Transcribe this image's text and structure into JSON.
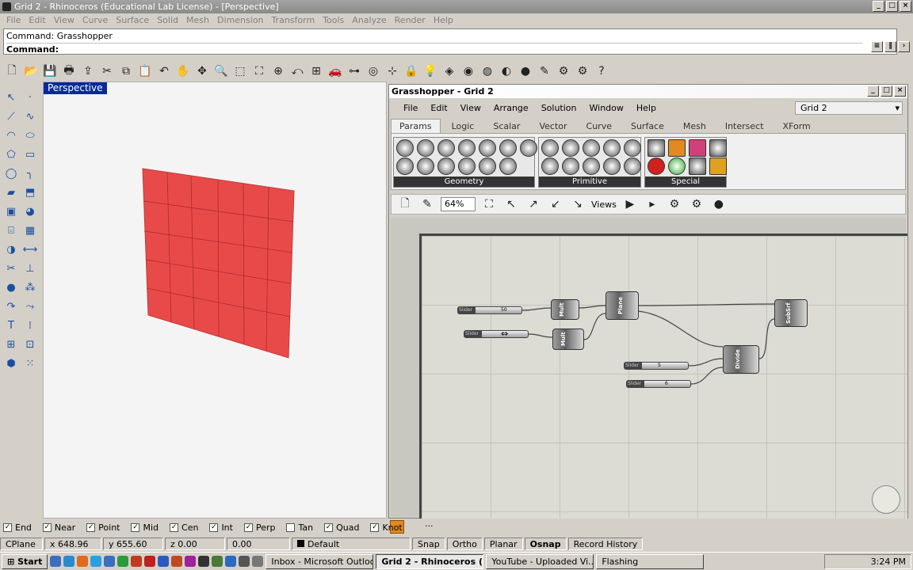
{
  "window": {
    "title": "Grid 2 - Rhinoceros (Educational Lab License) - [Perspective]"
  },
  "menu": [
    "File",
    "Edit",
    "View",
    "Curve",
    "Surface",
    "Solid",
    "Mesh",
    "Dimension",
    "Transform",
    "Tools",
    "Analyze",
    "Render",
    "Help"
  ],
  "command": {
    "line1": "Command: Grasshopper",
    "line2": "Command:"
  },
  "viewport": {
    "title": "Perspective",
    "surface_color": "#e84a4a"
  },
  "grasshopper": {
    "title": "Grasshopper - Grid 2",
    "menu": [
      "File",
      "Edit",
      "View",
      "Arrange",
      "Solution",
      "Window",
      "Help"
    ],
    "document": "Grid 2",
    "tabs": [
      "Params",
      "Logic",
      "Scalar",
      "Vector",
      "Curve",
      "Surface",
      "Mesh",
      "Intersect",
      "XForm"
    ],
    "active_tab": "Params",
    "groups": [
      "Geometry",
      "Primitive",
      "Special"
    ],
    "zoom": "64%",
    "views_label": "Views",
    "components": {
      "mult1": "Mult",
      "mult2": "Mult",
      "plane": "Plane",
      "divide": "Divide",
      "subsrf": "SubSrf"
    },
    "sliders": {
      "s1_tag": "Slider",
      "s1_val": "50",
      "s2_tag": "Slider",
      "s3_tag": "Slider",
      "s3_val": "5",
      "s4_tag": "Slider",
      "s4_val": "6"
    },
    "status_dots": "···"
  },
  "osnap": [
    {
      "label": "End",
      "checked": true
    },
    {
      "label": "Near",
      "checked": true
    },
    {
      "label": "Point",
      "checked": true
    },
    {
      "label": "Mid",
      "checked": true
    },
    {
      "label": "Cen",
      "checked": true
    },
    {
      "label": "Int",
      "checked": true
    },
    {
      "label": "Perp",
      "checked": true
    },
    {
      "label": "Tan",
      "checked": false
    },
    {
      "label": "Quad",
      "checked": true
    },
    {
      "label": "Knot",
      "checked": true
    }
  ],
  "status": {
    "cplane": "CPlane",
    "x": "x 648.96",
    "y": "y 655.60",
    "z": "z 0.00",
    "d": "0.00",
    "layer": "Default",
    "snap": "Snap",
    "ortho": "Ortho",
    "planar": "Planar",
    "osnap": "Osnap",
    "record": "Record History"
  },
  "taskbar": {
    "start": "Start",
    "tasks": [
      "Inbox - Microsoft Outlook",
      "Grid 2 - Rhinoceros (...",
      "YouTube - Uploaded Vi...",
      "Flashing"
    ],
    "active_index": 1,
    "clock": "3:24 PM"
  }
}
